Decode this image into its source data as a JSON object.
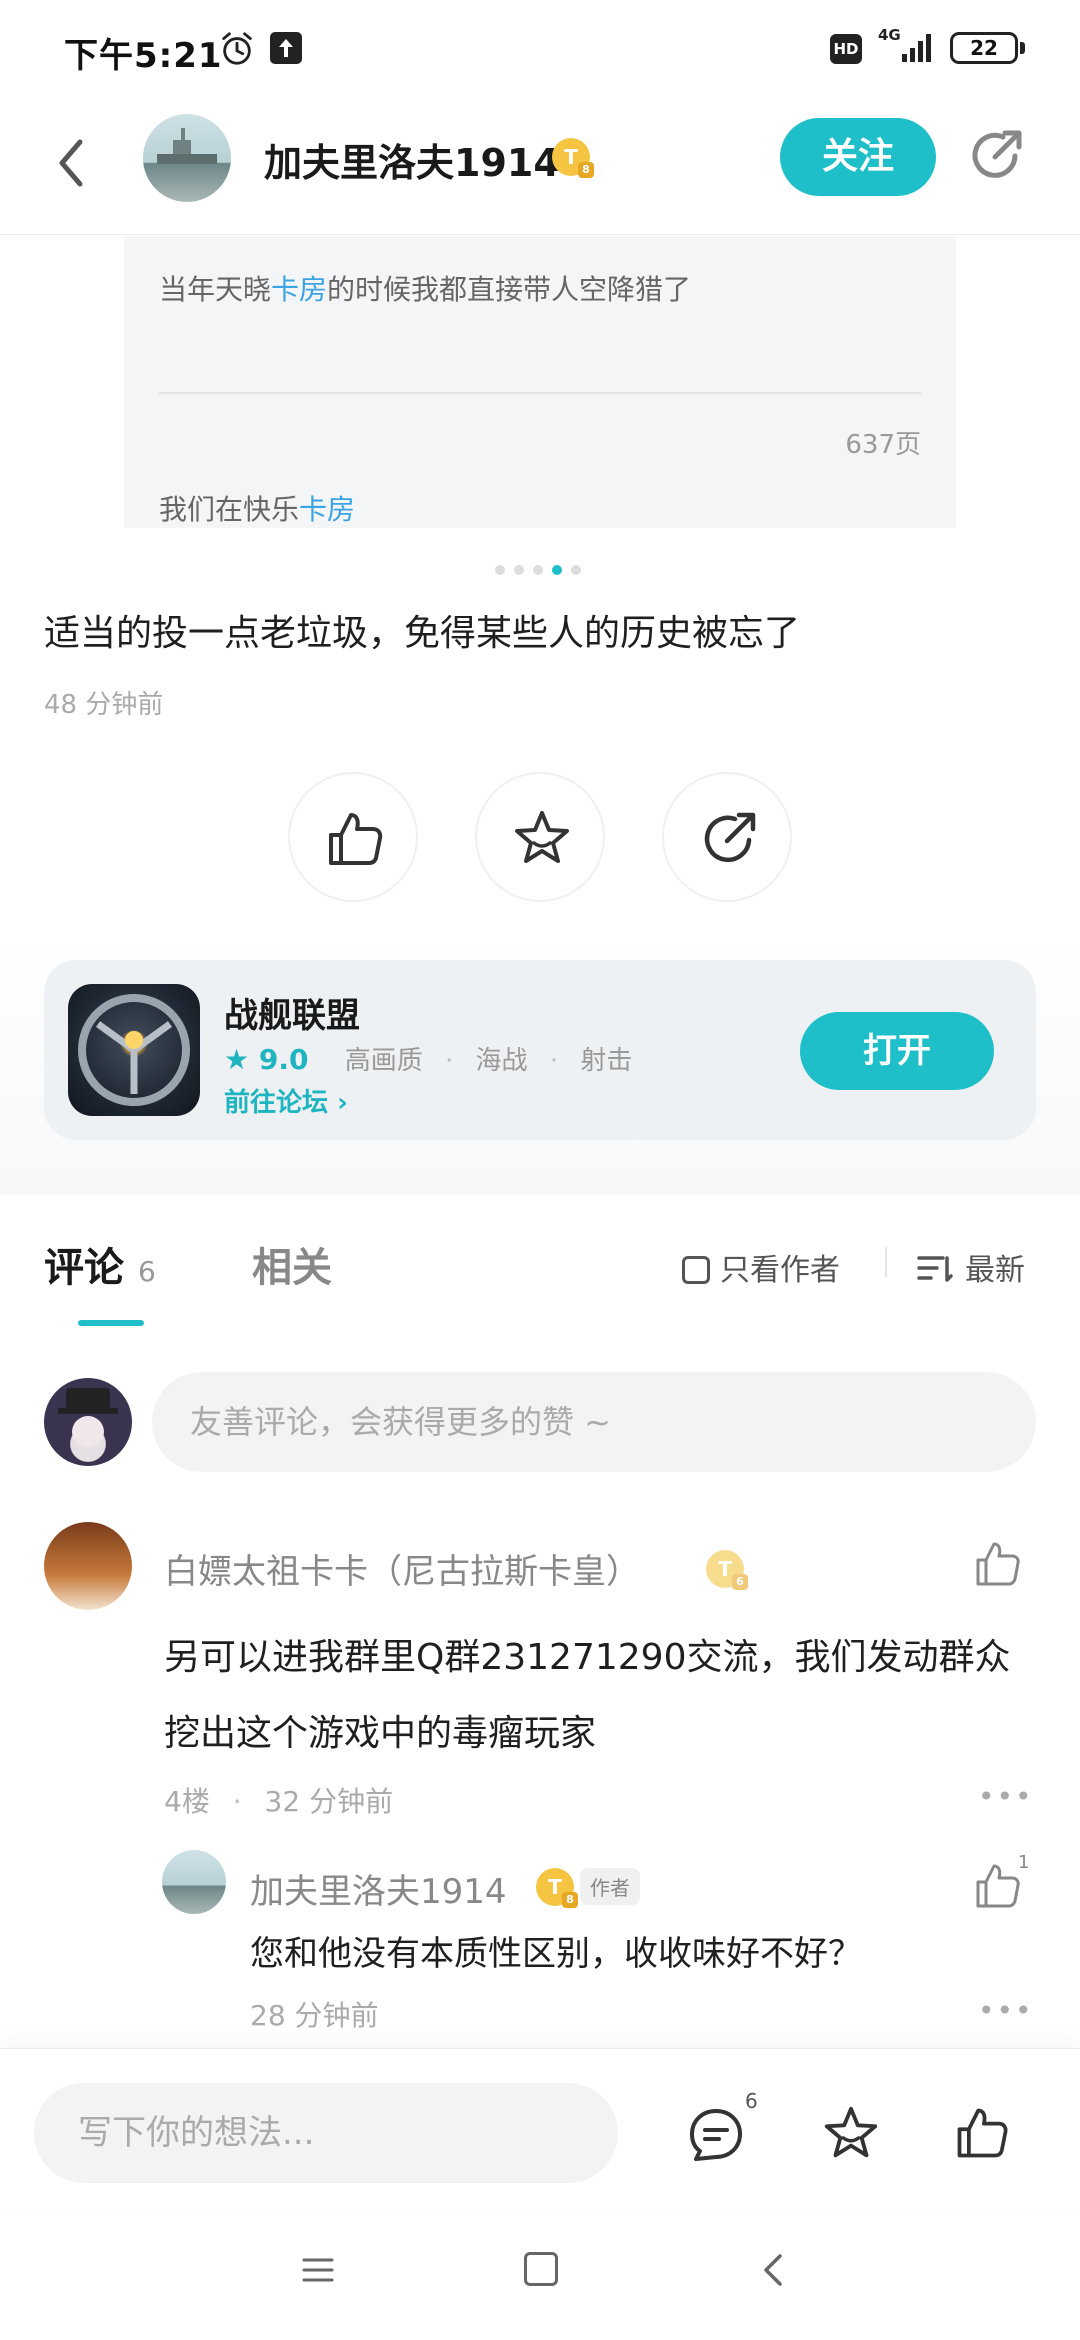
{
  "status_bar": {
    "time": "下午5:21",
    "hd": "HD",
    "network": "4G",
    "battery": "22"
  },
  "header": {
    "username": "加夫里洛夫1914",
    "badge": "T",
    "badge_level": "8",
    "follow_label": "关注"
  },
  "carousel": {
    "line1_before": "当年天晓",
    "line1_highlight": "卡房",
    "line1_after": "的时候我都直接带人空降猎了",
    "page_label": "637页",
    "line2_before": "我们在快乐",
    "line2_highlight": "卡房",
    "dots_total": 5,
    "dots_active": 4
  },
  "post": {
    "text": "适当的投一点老垃圾，免得某些人的历史被忘了",
    "time": "48 分钟前"
  },
  "game": {
    "name": "战舰联盟",
    "score": "9.0",
    "tags": [
      "高画质",
      "海战",
      "射击"
    ],
    "forum_link": "前往论坛",
    "open_label": "打开"
  },
  "tabs": {
    "comments_label": "评论",
    "comments_count": "6",
    "related_label": "相关",
    "only_author": "只看作者",
    "sort_label": "最新"
  },
  "comment_input": {
    "placeholder": "友善评论，会获得更多的赞 ~"
  },
  "comments": [
    {
      "name": "白嫖太祖卡卡（尼古拉斯卡皇）",
      "badge": "T",
      "badge_level": "6",
      "text": "另可以进我群里Q群231271290交流，我们发动群众挖出这个游戏中的毒瘤玩家",
      "floor": "4楼",
      "time": "32 分钟前",
      "reply": {
        "name": "加夫里洛夫1914",
        "badge": "T",
        "badge_level": "8",
        "author_tag": "作者",
        "text": "您和他没有本质性区别，收收味好不好？",
        "time": "28 分钟前",
        "likes": "1"
      }
    }
  ],
  "bottom_bar": {
    "placeholder": "写下你的想法...",
    "comment_count": "6"
  },
  "colors": {
    "accent": "#1fbfc9",
    "highlight_link": "#3aa3e3",
    "badge_gold": "#f5c542"
  }
}
